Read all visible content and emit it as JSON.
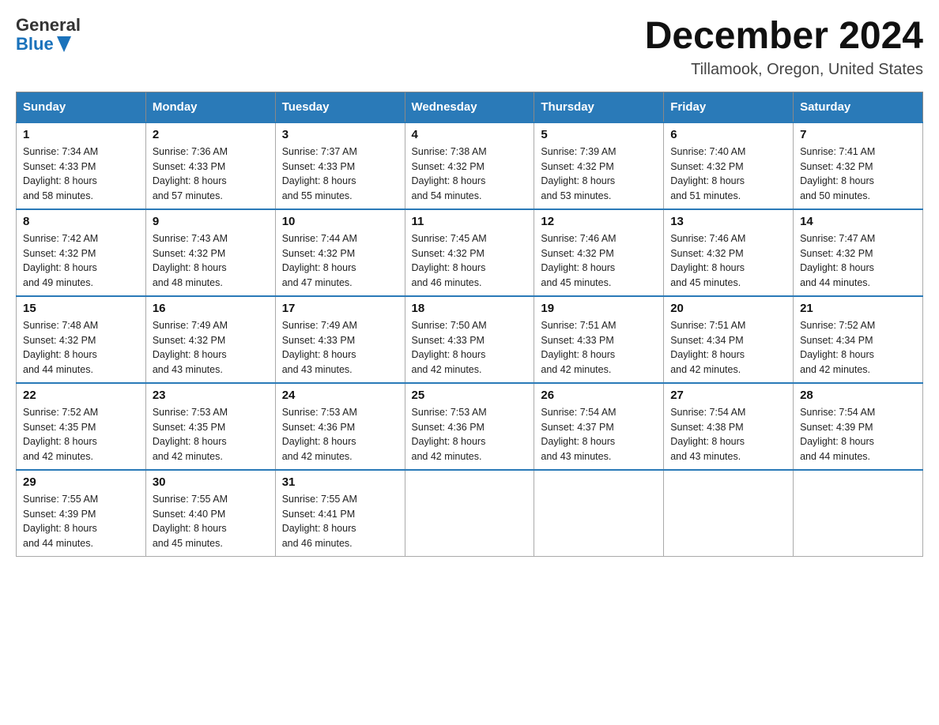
{
  "header": {
    "logo": {
      "general": "General",
      "blue": "Blue"
    },
    "title": "December 2024",
    "location": "Tillamook, Oregon, United States"
  },
  "days_header": [
    "Sunday",
    "Monday",
    "Tuesday",
    "Wednesday",
    "Thursday",
    "Friday",
    "Saturday"
  ],
  "weeks": [
    [
      {
        "day": "1",
        "sunrise": "7:34 AM",
        "sunset": "4:33 PM",
        "daylight": "8 hours and 58 minutes."
      },
      {
        "day": "2",
        "sunrise": "7:36 AM",
        "sunset": "4:33 PM",
        "daylight": "8 hours and 57 minutes."
      },
      {
        "day": "3",
        "sunrise": "7:37 AM",
        "sunset": "4:33 PM",
        "daylight": "8 hours and 55 minutes."
      },
      {
        "day": "4",
        "sunrise": "7:38 AM",
        "sunset": "4:32 PM",
        "daylight": "8 hours and 54 minutes."
      },
      {
        "day": "5",
        "sunrise": "7:39 AM",
        "sunset": "4:32 PM",
        "daylight": "8 hours and 53 minutes."
      },
      {
        "day": "6",
        "sunrise": "7:40 AM",
        "sunset": "4:32 PM",
        "daylight": "8 hours and 51 minutes."
      },
      {
        "day": "7",
        "sunrise": "7:41 AM",
        "sunset": "4:32 PM",
        "daylight": "8 hours and 50 minutes."
      }
    ],
    [
      {
        "day": "8",
        "sunrise": "7:42 AM",
        "sunset": "4:32 PM",
        "daylight": "8 hours and 49 minutes."
      },
      {
        "day": "9",
        "sunrise": "7:43 AM",
        "sunset": "4:32 PM",
        "daylight": "8 hours and 48 minutes."
      },
      {
        "day": "10",
        "sunrise": "7:44 AM",
        "sunset": "4:32 PM",
        "daylight": "8 hours and 47 minutes."
      },
      {
        "day": "11",
        "sunrise": "7:45 AM",
        "sunset": "4:32 PM",
        "daylight": "8 hours and 46 minutes."
      },
      {
        "day": "12",
        "sunrise": "7:46 AM",
        "sunset": "4:32 PM",
        "daylight": "8 hours and 45 minutes."
      },
      {
        "day": "13",
        "sunrise": "7:46 AM",
        "sunset": "4:32 PM",
        "daylight": "8 hours and 45 minutes."
      },
      {
        "day": "14",
        "sunrise": "7:47 AM",
        "sunset": "4:32 PM",
        "daylight": "8 hours and 44 minutes."
      }
    ],
    [
      {
        "day": "15",
        "sunrise": "7:48 AM",
        "sunset": "4:32 PM",
        "daylight": "8 hours and 44 minutes."
      },
      {
        "day": "16",
        "sunrise": "7:49 AM",
        "sunset": "4:32 PM",
        "daylight": "8 hours and 43 minutes."
      },
      {
        "day": "17",
        "sunrise": "7:49 AM",
        "sunset": "4:33 PM",
        "daylight": "8 hours and 43 minutes."
      },
      {
        "day": "18",
        "sunrise": "7:50 AM",
        "sunset": "4:33 PM",
        "daylight": "8 hours and 42 minutes."
      },
      {
        "day": "19",
        "sunrise": "7:51 AM",
        "sunset": "4:33 PM",
        "daylight": "8 hours and 42 minutes."
      },
      {
        "day": "20",
        "sunrise": "7:51 AM",
        "sunset": "4:34 PM",
        "daylight": "8 hours and 42 minutes."
      },
      {
        "day": "21",
        "sunrise": "7:52 AM",
        "sunset": "4:34 PM",
        "daylight": "8 hours and 42 minutes."
      }
    ],
    [
      {
        "day": "22",
        "sunrise": "7:52 AM",
        "sunset": "4:35 PM",
        "daylight": "8 hours and 42 minutes."
      },
      {
        "day": "23",
        "sunrise": "7:53 AM",
        "sunset": "4:35 PM",
        "daylight": "8 hours and 42 minutes."
      },
      {
        "day": "24",
        "sunrise": "7:53 AM",
        "sunset": "4:36 PM",
        "daylight": "8 hours and 42 minutes."
      },
      {
        "day": "25",
        "sunrise": "7:53 AM",
        "sunset": "4:36 PM",
        "daylight": "8 hours and 42 minutes."
      },
      {
        "day": "26",
        "sunrise": "7:54 AM",
        "sunset": "4:37 PM",
        "daylight": "8 hours and 43 minutes."
      },
      {
        "day": "27",
        "sunrise": "7:54 AM",
        "sunset": "4:38 PM",
        "daylight": "8 hours and 43 minutes."
      },
      {
        "day": "28",
        "sunrise": "7:54 AM",
        "sunset": "4:39 PM",
        "daylight": "8 hours and 44 minutes."
      }
    ],
    [
      {
        "day": "29",
        "sunrise": "7:55 AM",
        "sunset": "4:39 PM",
        "daylight": "8 hours and 44 minutes."
      },
      {
        "day": "30",
        "sunrise": "7:55 AM",
        "sunset": "4:40 PM",
        "daylight": "8 hours and 45 minutes."
      },
      {
        "day": "31",
        "sunrise": "7:55 AM",
        "sunset": "4:41 PM",
        "daylight": "8 hours and 46 minutes."
      },
      null,
      null,
      null,
      null
    ]
  ],
  "labels": {
    "sunrise": "Sunrise:",
    "sunset": "Sunset:",
    "daylight": "Daylight:"
  }
}
